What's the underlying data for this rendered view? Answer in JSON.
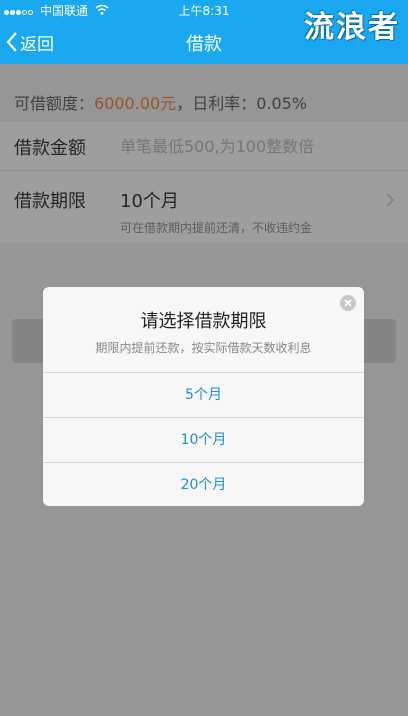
{
  "status_bar": {
    "carrier": "中国联通",
    "time": "上午8:31"
  },
  "watermark": "流浪者",
  "nav": {
    "back_label": "返回",
    "title": "借款"
  },
  "quota": {
    "label": "可借额度：",
    "amount": "6000.00元",
    "rate_label": "，日利率：",
    "rate": "0.05%"
  },
  "amount_field": {
    "label": "借款金额",
    "placeholder": "单笔最低500,为100整数倍",
    "value": ""
  },
  "term_field": {
    "label": "借款期限",
    "value": "10个月",
    "hint": "可在借款期内提前还清，不收违约金"
  },
  "dialog": {
    "title": "请选择借款期限",
    "subtitle": "期限内提前还款，按实际借款天数收利息",
    "options": [
      "5个月",
      "10个月",
      "20个月"
    ]
  },
  "colors": {
    "header": "#1aa8f0",
    "accent_orange": "#ef7b2b",
    "option_blue": "#1e8fd1"
  }
}
